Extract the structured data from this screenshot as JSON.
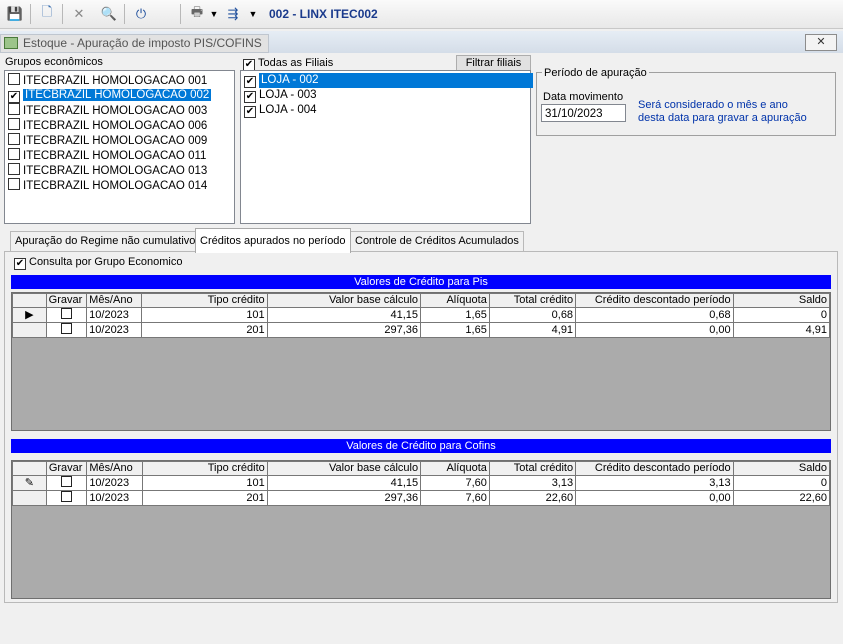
{
  "toolbar": {
    "title": "002 - LINX ITEC002",
    "icons": [
      "save-icon",
      "new-doc-icon",
      "cancel-icon",
      "search-icon",
      "power-icon",
      "print-icon",
      "dropdown-icon",
      "export-icon",
      "dropdown-icon"
    ]
  },
  "window": {
    "title": "Estoque - Apuração de imposto PIS/COFINS",
    "close_glyph": "✕"
  },
  "groups": {
    "label": "Grupos econômicos",
    "items": [
      {
        "label": "ITECBRAZIL HOMOLOGACAO 001",
        "checked": false,
        "selected": false
      },
      {
        "label": "ITECBRAZIL HOMOLOGACAO 002",
        "checked": true,
        "selected": true
      },
      {
        "label": "ITECBRAZIL HOMOLOGACAO 003",
        "checked": false,
        "selected": false
      },
      {
        "label": "ITECBRAZIL HOMOLOGACAO 006",
        "checked": false,
        "selected": false
      },
      {
        "label": "ITECBRAZIL HOMOLOGACAO 009",
        "checked": false,
        "selected": false
      },
      {
        "label": "ITECBRAZIL HOMOLOGACAO 011",
        "checked": false,
        "selected": false
      },
      {
        "label": "ITECBRAZIL HOMOLOGACAO 013",
        "checked": false,
        "selected": false
      },
      {
        "label": "ITECBRAZIL HOMOLOGACAO 014",
        "checked": false,
        "selected": false
      }
    ]
  },
  "filiais": {
    "all_label": "Todas as Filiais",
    "all_checked": true,
    "filter_button": "Filtrar filiais",
    "items": [
      {
        "label": "LOJA - 002",
        "checked": true,
        "selected": true
      },
      {
        "label": "LOJA - 003",
        "checked": true,
        "selected": false
      },
      {
        "label": "LOJA - 004",
        "checked": true,
        "selected": false
      }
    ]
  },
  "periodo": {
    "legend": "Período de apuração",
    "date_label": "Data  movimento",
    "date_value": "31/10/2023",
    "note_line1": "Será considerado o mês e ano",
    "note_line2": "desta data para gravar a apuração"
  },
  "tabs": [
    {
      "label": "Apuração do Regime não cumulativo"
    },
    {
      "label": "Créditos apurados no período"
    },
    {
      "label": "Controle de Créditos Acumulados"
    }
  ],
  "consulta": {
    "label": "Consulta por Grupo Economico",
    "checked": true
  },
  "columns": [
    "Gravar",
    "Mês/Ano",
    "Tipo crédito",
    "Valor base cálculo",
    "Alíquota",
    "Total crédito",
    "Crédito descontado período",
    "Saldo"
  ],
  "pis": {
    "title": "Valores de Crédito para Pis",
    "rows": [
      {
        "indicator": "▶",
        "mes": "10/2023",
        "tipo": "101",
        "base": "41,15",
        "aliquota": "1,65",
        "total": "0,68",
        "desc": "0,68",
        "saldo": "0"
      },
      {
        "indicator": "",
        "mes": "10/2023",
        "tipo": "201",
        "base": "297,36",
        "aliquota": "1,65",
        "total": "4,91",
        "desc": "0,00",
        "saldo": "4,91"
      }
    ]
  },
  "cofins": {
    "title": "Valores de Crédito para Cofins",
    "rows": [
      {
        "indicator": "✎",
        "mes": "10/2023",
        "tipo": "101",
        "base": "41,15",
        "aliquota": "7,60",
        "total": "3,13",
        "desc": "3,13",
        "saldo": "0"
      },
      {
        "indicator": "",
        "mes": "10/2023",
        "tipo": "201",
        "base": "297,36",
        "aliquota": "7,60",
        "total": "22,60",
        "desc": "0,00",
        "saldo": "22,60"
      }
    ]
  }
}
